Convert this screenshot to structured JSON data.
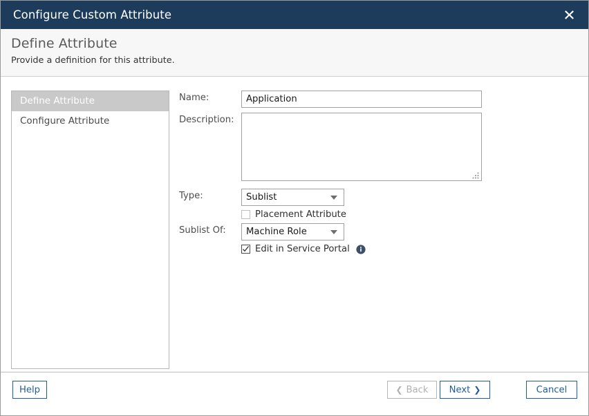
{
  "window": {
    "title": "Configure Custom Attribute",
    "close_icon": "close-x-icon"
  },
  "header": {
    "heading": "Define Attribute",
    "description": "Provide a definition for this attribute."
  },
  "sidebar": {
    "items": [
      {
        "label": "Define Attribute",
        "selected": true
      },
      {
        "label": "Configure Attribute",
        "selected": false
      }
    ]
  },
  "form": {
    "name": {
      "label": "Name:",
      "value": "Application",
      "placeholder": ""
    },
    "description": {
      "label": "Description:",
      "value": "",
      "placeholder": ""
    },
    "type": {
      "label": "Type:",
      "value": "Sublist",
      "options": [
        "Sublist"
      ],
      "arrow_icon": "chevron-down-icon"
    },
    "placement_attribute": {
      "label": "Placement Attribute",
      "checked": false,
      "enabled": false
    },
    "sublist_of": {
      "label": "Sublist Of:",
      "value": "Machine Role",
      "options": [
        "Machine Role"
      ],
      "arrow_icon": "chevron-down-icon"
    },
    "edit_in_service_portal": {
      "label": "Edit in Service Portal",
      "checked": true,
      "info_icon": "info-circle-icon"
    }
  },
  "footer": {
    "help": "Help",
    "back": "Back",
    "back_icon": "chevron-left-icon",
    "back_disabled": true,
    "next": "Next",
    "next_icon": "chevron-right-icon",
    "cancel": "Cancel"
  },
  "colors": {
    "titlebar": "#1d3c5c",
    "accent": "#1f5c9e",
    "selected_item": "#c9c9c9",
    "subheader_bg": "#f7f7f7"
  }
}
